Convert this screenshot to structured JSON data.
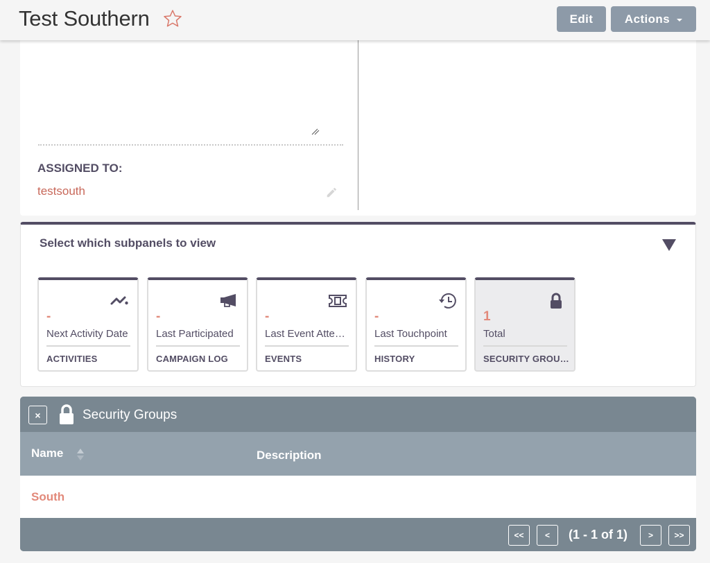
{
  "header": {
    "title": "Test Southern",
    "favorite_icon": "star-outline-icon",
    "edit_label": "Edit",
    "actions_label": "Actions"
  },
  "detail": {
    "assigned_label": "ASSIGNED TO:",
    "assigned_value": "testsouth",
    "edit_icon": "pencil-icon"
  },
  "subpanel_selector": {
    "heading": "Select which subpanels to view",
    "toggle_icon": "triangle-down-icon",
    "tiles": [
      {
        "icon": "activity-chart-icon",
        "value": "-",
        "subtitle": "Next Activity Date",
        "name": "ACTIVITIES",
        "active": false
      },
      {
        "icon": "megaphone-icon",
        "value": "-",
        "subtitle": "Last Participated",
        "name": "CAMPAIGN LOG",
        "active": false
      },
      {
        "icon": "ticket-icon",
        "value": "-",
        "subtitle": "Last Event Attended",
        "name": "EVENTS",
        "active": false
      },
      {
        "icon": "history-clock-icon",
        "value": "-",
        "subtitle": "Last Touchpoint",
        "name": "HISTORY",
        "active": false
      },
      {
        "icon": "lock-icon",
        "value": "1",
        "subtitle": "Total",
        "name": "SECURITY GROUPS",
        "active": true
      }
    ]
  },
  "security_groups": {
    "title": "Security Groups",
    "close_label": "×",
    "columns": {
      "name": "Name",
      "description": "Description"
    },
    "rows": [
      {
        "name": "South",
        "description": ""
      }
    ],
    "pagination": {
      "first": "<<",
      "prev": "<",
      "info": "(1 - 1 of 1)",
      "next": ">",
      "last": ">>"
    }
  },
  "colors": {
    "accent": "#c8685a",
    "value_accent": "#e2897a",
    "primary_dark": "#534d64",
    "button_bg": "#8d9aa8",
    "subpanel_header": "#798791",
    "subpanel_colhead": "#94a2ad"
  }
}
